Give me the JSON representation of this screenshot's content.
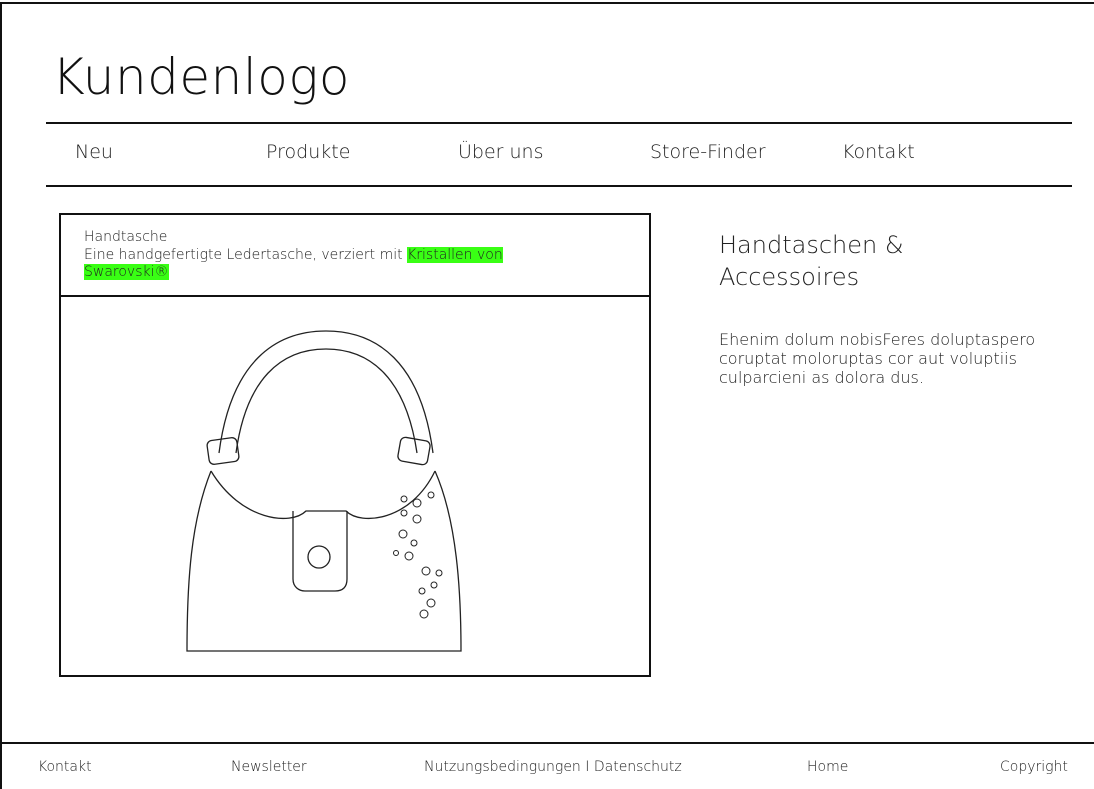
{
  "header": {
    "logo": "Kundenlogo"
  },
  "nav": {
    "items": [
      "Neu",
      "Produkte",
      "Über uns",
      "Store-Finder",
      "Kontakt"
    ]
  },
  "product": {
    "title": "Handtasche",
    "description_prefix": "Eine handgefertigte Ledertasche, verziert mit ",
    "description_highlight": "Kristallen von Swarovski®",
    "highlight_color": "#39ff14",
    "image_icon": "handbag-icon"
  },
  "aside": {
    "title": "Handtaschen & Accessoires",
    "text": "Ehenim dolum nobisFeres doluptaspero coruptat moloruptas cor aut voluptiis culparcieni as dolora dus."
  },
  "footer": {
    "items": [
      "Kontakt",
      "Newsletter",
      "Nutzungsbedingungen I Datenschutz",
      "Home",
      "Copyright"
    ]
  }
}
